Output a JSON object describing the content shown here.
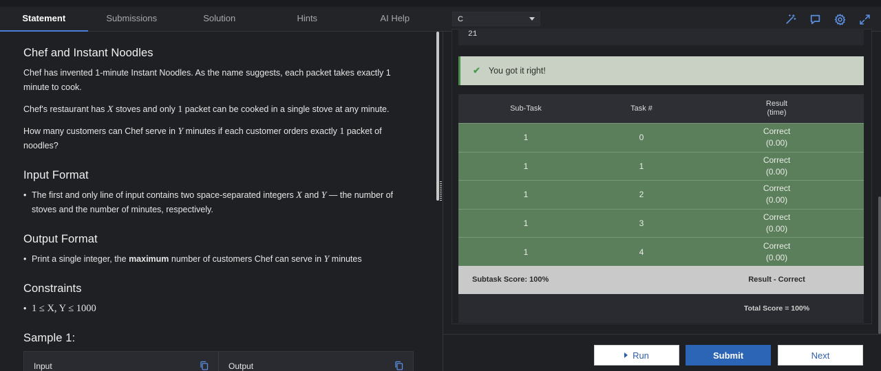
{
  "tabs": [
    {
      "label": "Statement"
    },
    {
      "label": "Submissions"
    },
    {
      "label": "Solution"
    },
    {
      "label": "Hints"
    },
    {
      "label": "AI Help"
    }
  ],
  "language": {
    "selected": "C"
  },
  "toolbar_icons": [
    "magic-wand-icon",
    "feedback-icon",
    "settings-gear-icon",
    "fullscreen-icon"
  ],
  "problem": {
    "title": "Chef and Instant Noodles",
    "p1": "Chef has invented 1-minute Instant Noodles. As the name suggests, each packet takes exactly 1 minute to cook.",
    "p2_pre": "Chef's restaurant has ",
    "p2_var": "X",
    "p2_mid": " stoves and only ",
    "p2_num": "1",
    "p2_post": " packet can be cooked in a single stove at any minute.",
    "p3_pre": "How many customers can Chef serve in ",
    "p3_var": "Y",
    "p3_mid": " minutes if each customer orders exactly ",
    "p3_num": "1",
    "p3_post": " packet of noodles?",
    "input_heading": "Input Format",
    "input_pre": "The first and only line of input contains two space-separated integers ",
    "input_x": "X",
    "input_and": " and ",
    "input_y": "Y",
    "input_post": " — the number of stoves and the number of minutes, respectively.",
    "output_heading": "Output Format",
    "output_pre": "Print a single integer, the ",
    "output_bold": "maximum",
    "output_mid": " number of customers Chef can serve in ",
    "output_var": "Y",
    "output_post": " minutes",
    "constraints_heading": "Constraints",
    "constraint": "1 ≤ X, Y ≤ 1000",
    "sample_heading": "Sample 1:",
    "sample_input_label": "Input",
    "sample_output_label": "Output"
  },
  "output_value": "21",
  "verdict": "You got it right!",
  "results": {
    "headers": {
      "subtask": "Sub-Task",
      "task": "Task #",
      "result_line1": "Result",
      "result_line2": "(time)"
    },
    "rows": [
      {
        "subtask": "1",
        "task": "0",
        "status": "Correct",
        "time": "(0.00)"
      },
      {
        "subtask": "1",
        "task": "1",
        "status": "Correct",
        "time": "(0.00)"
      },
      {
        "subtask": "1",
        "task": "2",
        "status": "Correct",
        "time": "(0.00)"
      },
      {
        "subtask": "1",
        "task": "3",
        "status": "Correct",
        "time": "(0.00)"
      },
      {
        "subtask": "1",
        "task": "4",
        "status": "Correct",
        "time": "(0.00)"
      }
    ],
    "subtask_score": "Subtask Score: 100%",
    "subtask_result": "Result - Correct",
    "total_score": "Total Score = 100%"
  },
  "buttons": {
    "run": "Run",
    "submit": "Submit",
    "next": "Next"
  },
  "colors": {
    "accent": "#2c64b6",
    "success_bg": "#c9d1c5",
    "row_pass": "#5b7f5b"
  }
}
